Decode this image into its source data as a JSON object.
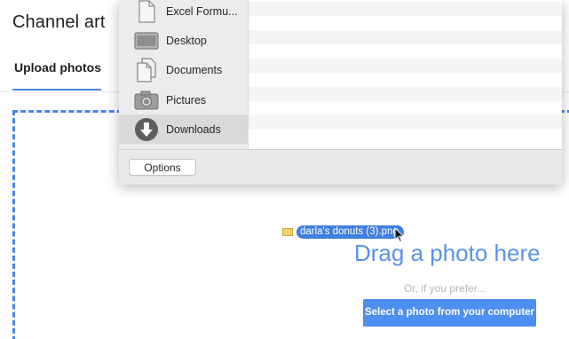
{
  "background_dialog": {
    "title": "Channel art",
    "tabs": [
      {
        "label": "Upload photos",
        "active": true
      }
    ],
    "drop_zone": {
      "headline": "Drag a photo here",
      "subtext": "Or, if you prefer...",
      "select_button_label": "Select a photo from your computer"
    }
  },
  "file_picker": {
    "sidebar": {
      "items": [
        {
          "label": "Excel Formu...",
          "icon": "document-icon",
          "selected": false
        },
        {
          "label": "Desktop",
          "icon": "desktop-folder-icon",
          "selected": false
        },
        {
          "label": "Documents",
          "icon": "documents-icon",
          "selected": false
        },
        {
          "label": "Pictures",
          "icon": "camera-icon",
          "selected": false
        },
        {
          "label": "Downloads",
          "icon": "downloads-icon",
          "selected": true
        }
      ]
    },
    "options_button_label": "Options"
  },
  "dragged_file": {
    "name": "darla's donuts (3).png",
    "icon": "image-file-icon"
  },
  "colors": {
    "accent": "#4a86e8",
    "button_blue": "#4d8ff0",
    "drag_text": "#5a93e9",
    "chip_blue": "#3f7fe0",
    "sidebar_bg": "#ececec",
    "sidebar_selected": "#d9d9d9"
  }
}
